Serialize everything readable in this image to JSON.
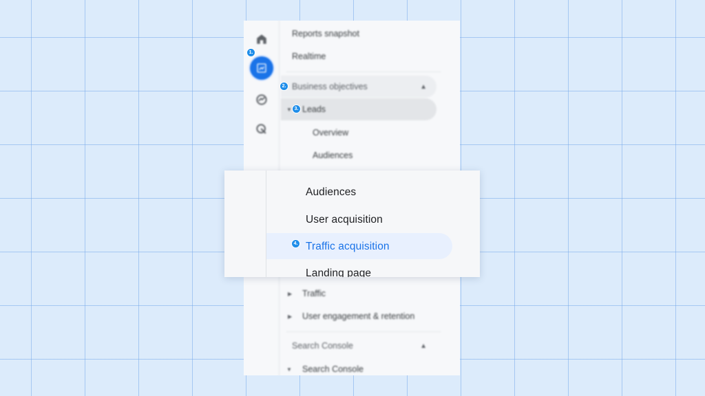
{
  "sidebar": {
    "items": {
      "reports_snapshot": "Reports snapshot",
      "realtime": "Realtime",
      "business_objectives": "Business objectives",
      "leads": "Leads",
      "overview": "Overview",
      "audiences": "Audiences",
      "traffic": "Traffic",
      "user_engagement": "User engagement & retention",
      "search_console_header": "Search Console",
      "search_console": "Search Console"
    },
    "badges": {
      "b1": "1.",
      "b2": "2.",
      "b3": "3.",
      "b4": "4."
    }
  },
  "zoom": {
    "items": [
      "Audiences",
      "User acquisition",
      "Traffic acquisition",
      "Landing page"
    ],
    "active": "Traffic acquisition"
  },
  "icons": [
    "home-icon",
    "reports-icon",
    "explore-icon",
    "advertising-icon",
    "chevron-up-icon",
    "expand-caret-icon"
  ],
  "colors": {
    "accent": "#1a73e8",
    "badge": "#1e8de9",
    "highlight": "#e8f0fe"
  }
}
